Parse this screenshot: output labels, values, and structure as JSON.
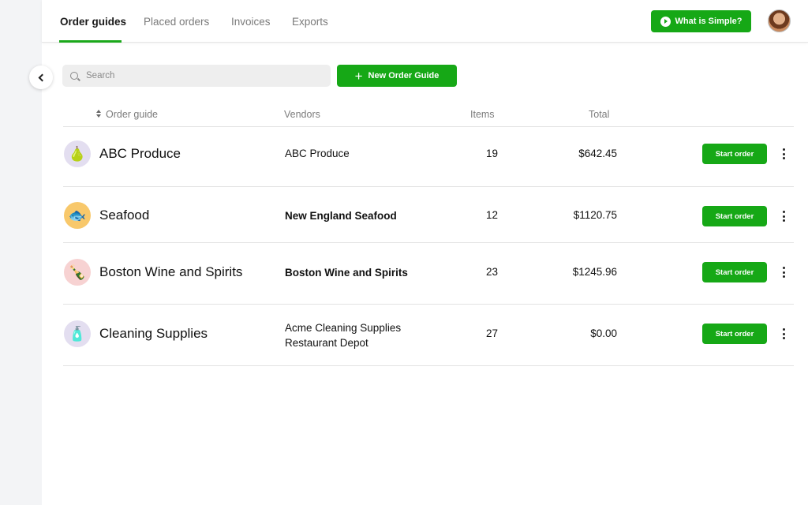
{
  "nav": {
    "tabs": [
      {
        "label": "Order guides",
        "active": true
      },
      {
        "label": "Placed orders",
        "active": false
      },
      {
        "label": "Invoices",
        "active": false
      },
      {
        "label": "Exports",
        "active": false
      }
    ],
    "help_button_label": "What is Simple?",
    "help_icon": "play-icon",
    "avatar_icon": "user-avatar"
  },
  "toolbar": {
    "search_placeholder": "Search",
    "search_value": "",
    "new_button_label": "New Order Guide",
    "new_button_icon": "plus-icon"
  },
  "table": {
    "columns": [
      "Order guide",
      "Vendors",
      "Items",
      "Total"
    ],
    "rows": [
      {
        "name": "ABC Produce",
        "icon": "fruit-icon",
        "vendors": [
          "ABC Produce"
        ],
        "vendors_bold": false,
        "items": "19",
        "total": "$642.45",
        "action": "Start order"
      },
      {
        "name": "Seafood",
        "icon": "fish-icon",
        "vendors": [
          "New England Seafood"
        ],
        "vendors_bold": true,
        "items": "12",
        "total": "$1120.75",
        "action": "Start order"
      },
      {
        "name": "Boston Wine and Spirits",
        "icon": "wine-icon",
        "vendors": [
          "Boston Wine and Spirits"
        ],
        "vendors_bold": true,
        "items": "23",
        "total": "$1245.96",
        "action": "Start order"
      },
      {
        "name": "Cleaning Supplies",
        "icon": "cleaning-icon",
        "vendors": [
          "Acme Cleaning Supplies",
          "Restaurant Depot"
        ],
        "vendors_bold": false,
        "items": "27",
        "total": "$0.00",
        "action": "Start order"
      }
    ]
  },
  "colors": {
    "accent": "#16a816",
    "sidebar_bg": "#f3f4f6"
  }
}
